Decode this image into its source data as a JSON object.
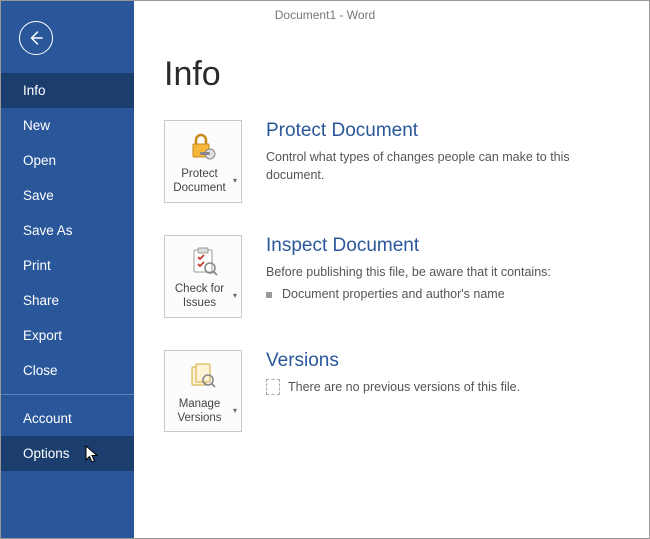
{
  "window": {
    "title": "Document1 - Word"
  },
  "sidebar": {
    "items": [
      {
        "label": "Info",
        "active": true
      },
      {
        "label": "New"
      },
      {
        "label": "Open"
      },
      {
        "label": "Save"
      },
      {
        "label": "Save As"
      },
      {
        "label": "Print"
      },
      {
        "label": "Share"
      },
      {
        "label": "Export"
      },
      {
        "label": "Close"
      }
    ],
    "footer": [
      {
        "label": "Account"
      },
      {
        "label": "Options",
        "hover": true
      }
    ]
  },
  "page": {
    "heading": "Info",
    "protect": {
      "button": "Protect Document",
      "title": "Protect Document",
      "desc": "Control what types of changes people can make to this document."
    },
    "inspect": {
      "button": "Check for Issues",
      "title": "Inspect Document",
      "desc": "Before publishing this file, be aware that it contains:",
      "items": [
        "Document properties and author's name"
      ]
    },
    "versions": {
      "button": "Manage Versions",
      "title": "Versions",
      "desc": "There are no previous versions of this file."
    }
  },
  "colors": {
    "accent": "#2a579a"
  }
}
